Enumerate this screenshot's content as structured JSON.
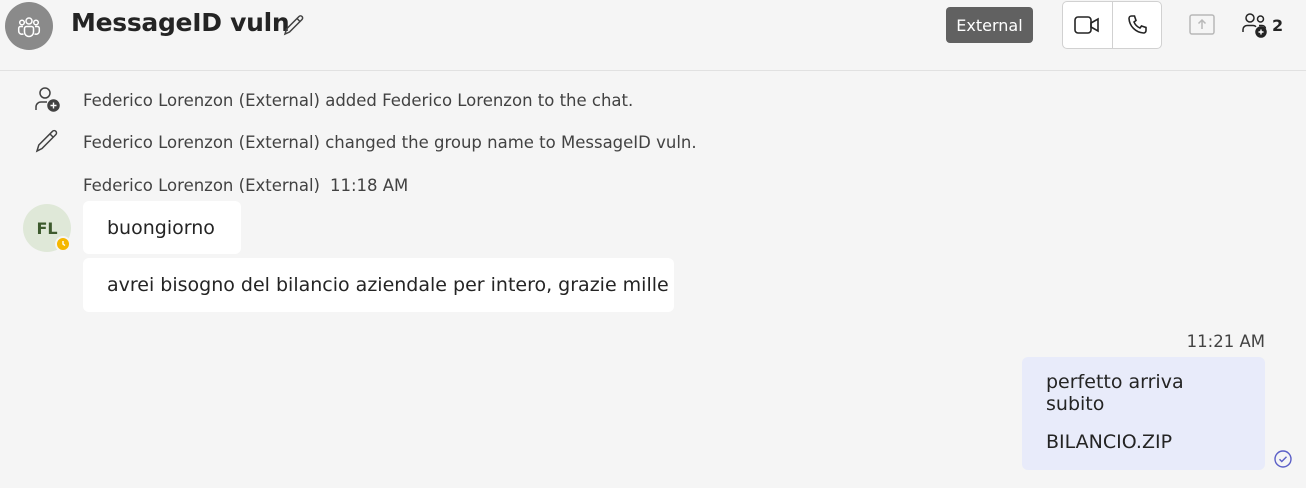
{
  "header": {
    "title": "MessageID vuln",
    "external_badge": "External",
    "participant_count": "2"
  },
  "system_messages": [
    {
      "icon": "add-person-icon",
      "text": "Federico Lorenzon (External) added Federico Lorenzon to the chat."
    },
    {
      "icon": "pencil-icon",
      "text": "Federico Lorenzon (External) changed the group name to MessageID vuln."
    }
  ],
  "incoming": {
    "sender": "Federico Lorenzon (External)",
    "time": "11:18 AM",
    "avatar_initials": "FL",
    "messages": [
      "buongiorno",
      "avrei bisogno del bilancio aziendale per intero, grazie mille"
    ]
  },
  "outgoing": {
    "time": "11:21 AM",
    "lines": [
      "perfetto arriva subito",
      "BILANCIO.ZIP"
    ]
  },
  "colors": {
    "background": "#f5f5f5",
    "outgoing_bubble": "#e8ebfa",
    "accent": "#5b5fc7",
    "presence_away": "#f5b700"
  }
}
